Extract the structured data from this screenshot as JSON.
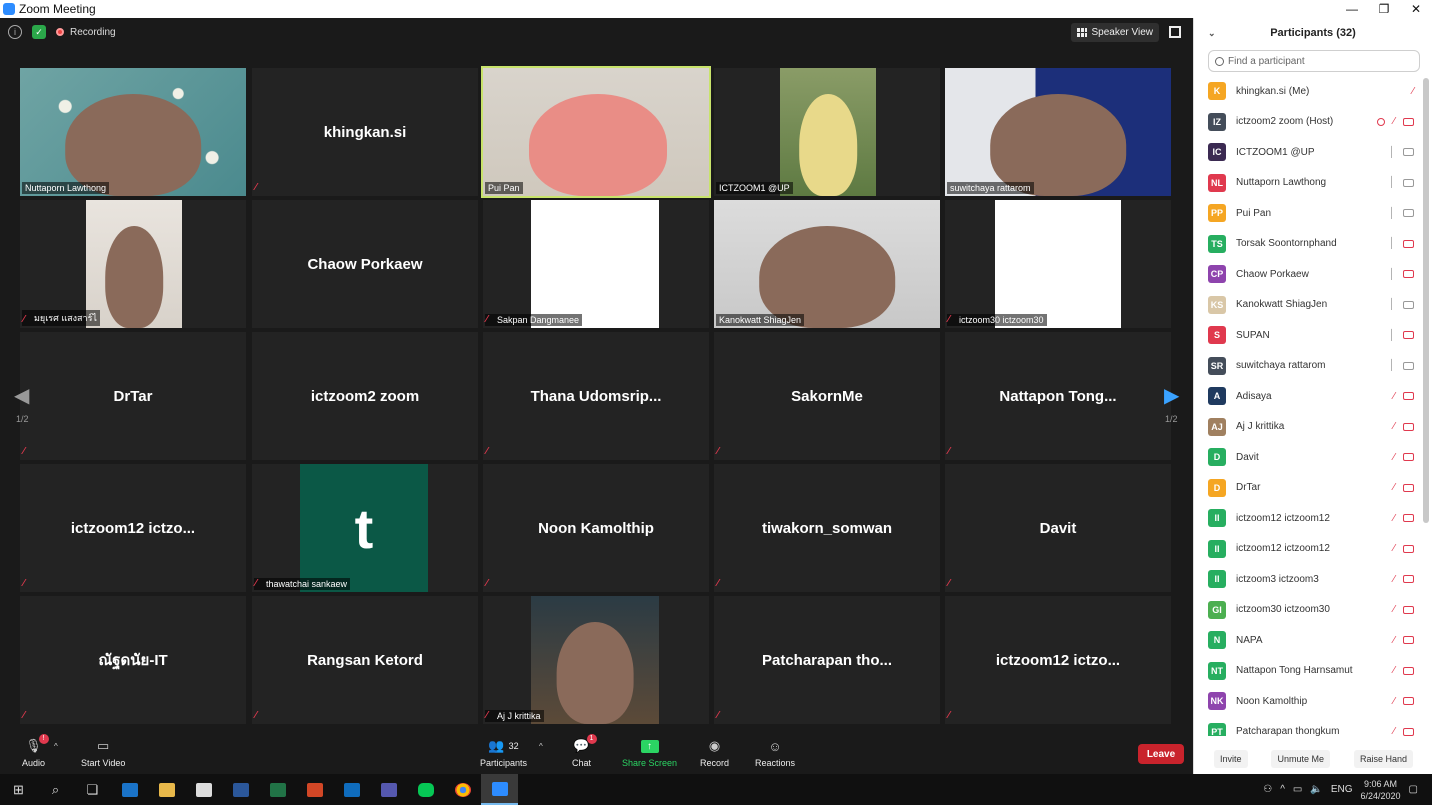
{
  "window": {
    "title": "Zoom Meeting",
    "minimize": "—",
    "restore": "❐",
    "close": "✕"
  },
  "topbar": {
    "recording_label": "Recording",
    "speaker_view_label": "Speaker View"
  },
  "grid": {
    "page_indicator_left": "1/2",
    "page_indicator_right": "1/2",
    "tiles": [
      {
        "name": "Nuttaporn Lawthong",
        "video": "blossom",
        "label": "Nuttaporn Lawthong"
      },
      {
        "name": "khingkan.si",
        "video": null,
        "muted": true
      },
      {
        "name": "Pui Pan",
        "video": "room",
        "label": "Pui Pan",
        "active": true
      },
      {
        "name": "ICTZOOM1 @UP",
        "video": "trees",
        "label": "ICTZOOM1 @UP"
      },
      {
        "name": "suwitchaya rattarom",
        "video": "office",
        "label": "suwitchaya rattarom"
      },
      {
        "name": "มยุเรศ แสงสาร์ไ",
        "video": "girl",
        "label": "มยุเรศ แสงสาร์ไ",
        "muted": true
      },
      {
        "name": "Chaow Porkaew",
        "video": null
      },
      {
        "name": "Sakpan Dangmanee",
        "video": "cartoon",
        "label": "Sakpan Dangmanee",
        "muted": true
      },
      {
        "name": "Kanokwatt ShiagJen",
        "video": "man2",
        "label": "Kanokwatt ShiagJen"
      },
      {
        "name": "ictzoom30 ictzoom30",
        "video": "gis",
        "label": "ictzoom30 ictzoom30",
        "muted": true
      },
      {
        "name": "DrTar",
        "video": null,
        "muted": true
      },
      {
        "name": "ictzoom2 zoom",
        "video": null
      },
      {
        "name": "Thana  Udomsrip...",
        "video": null,
        "muted": true
      },
      {
        "name": "SakornMe",
        "video": null,
        "muted": true
      },
      {
        "name": "Nattapon  Tong...",
        "video": null,
        "muted": true
      },
      {
        "name": "ictzoom12  ictzo...",
        "video": null,
        "muted": true
      },
      {
        "name": "thawatchai sankaew",
        "video": "t",
        "letter": "t",
        "label": "thawatchai sankaew",
        "muted": true
      },
      {
        "name": "Noon Kamolthip",
        "video": null,
        "muted": true
      },
      {
        "name": "tiwakorn_somwan",
        "video": null,
        "muted": true
      },
      {
        "name": "Davit",
        "video": null,
        "muted": true
      },
      {
        "name": "ณัฐดนัย-IT",
        "video": null,
        "muted": true
      },
      {
        "name": "Rangsan Ketord",
        "video": null,
        "muted": true
      },
      {
        "name": "Aj J krittika",
        "video": "night",
        "label": "Aj J krittika",
        "muted": true
      },
      {
        "name": "Patcharapan tho...",
        "video": null,
        "muted": true
      },
      {
        "name": "ictzoom12  ictzo...",
        "video": null,
        "muted": true
      }
    ]
  },
  "toolbar": {
    "audio": "Audio",
    "start_video": "Start Video",
    "participants": "Participants",
    "participants_count": "32",
    "chat": "Chat",
    "chat_badge": "1",
    "audio_badge": "!",
    "share_screen": "Share Screen",
    "record": "Record",
    "reactions": "Reactions",
    "leave": "Leave"
  },
  "participants": {
    "title": "Participants (32)",
    "search_placeholder": "Find a participant",
    "list": [
      {
        "initials": "K",
        "color": "#f5a623",
        "name": "khingkan.si (Me)",
        "mic": "muted",
        "cam": null
      },
      {
        "initials": "IZ",
        "color": "#444d5a",
        "name": "ictzoom2 zoom (Host)",
        "mic": "muted",
        "cam": "muted",
        "rec": true
      },
      {
        "initials": "IC",
        "color": "#3b2a52",
        "name": "ICTZOOM1 @UP",
        "mic": "on",
        "cam": "on"
      },
      {
        "initials": "NL",
        "color": "#e0394e",
        "name": "Nuttaporn Lawthong",
        "mic": "on",
        "cam": "on"
      },
      {
        "initials": "PP",
        "color": "#f5a623",
        "name": "Pui Pan",
        "mic": "on",
        "cam": "on"
      },
      {
        "initials": "TS",
        "color": "#27ae60",
        "name": "Torsak Soontornphand",
        "mic": "on",
        "cam": "muted"
      },
      {
        "initials": "CP",
        "color": "#8e44ad",
        "name": "Chaow Porkaew",
        "mic": "on",
        "cam": "muted"
      },
      {
        "initials": "KS",
        "color": "#d9c7a7",
        "name": "Kanokwatt ShiagJen",
        "mic": "on",
        "cam": "on"
      },
      {
        "initials": "S",
        "color": "#e0394e",
        "name": "SUPAN",
        "mic": "on",
        "cam": "muted"
      },
      {
        "initials": "SR",
        "color": "#444d5a",
        "name": "suwitchaya rattarom",
        "mic": "on",
        "cam": "on"
      },
      {
        "initials": "A",
        "color": "#1f3a5f",
        "name": "Adisaya",
        "mic": "muted",
        "cam": "muted"
      },
      {
        "initials": "AJ",
        "color": "#a08060",
        "name": "Aj J krittika",
        "mic": "muted",
        "cam": "muted"
      },
      {
        "initials": "D",
        "color": "#27ae60",
        "name": "Davit",
        "mic": "muted",
        "cam": "muted"
      },
      {
        "initials": "D",
        "color": "#f5a623",
        "name": "DrTar",
        "mic": "muted",
        "cam": "muted"
      },
      {
        "initials": "II",
        "color": "#27ae60",
        "name": "ictzoom12 ictzoom12",
        "mic": "muted",
        "cam": "muted"
      },
      {
        "initials": "II",
        "color": "#27ae60",
        "name": "ictzoom12 ictzoom12",
        "mic": "muted",
        "cam": "muted"
      },
      {
        "initials": "II",
        "color": "#27ae60",
        "name": "ictzoom3 ictzoom3",
        "mic": "muted",
        "cam": "muted"
      },
      {
        "initials": "GI",
        "color": "#4caf50",
        "name": "ictzoom30 ictzoom30",
        "mic": "muted",
        "cam": "muted"
      },
      {
        "initials": "N",
        "color": "#27ae60",
        "name": "NAPA",
        "mic": "muted",
        "cam": "muted"
      },
      {
        "initials": "NT",
        "color": "#27ae60",
        "name": "Nattapon Tong Harnsamut",
        "mic": "muted",
        "cam": "muted"
      },
      {
        "initials": "NK",
        "color": "#8e44ad",
        "name": "Noon Kamolthip",
        "mic": "muted",
        "cam": "muted"
      },
      {
        "initials": "PT",
        "color": "#27ae60",
        "name": "Patcharapan thongkum",
        "mic": "muted",
        "cam": "muted"
      }
    ],
    "footer": {
      "invite": "Invite",
      "unmute_me": "Unmute Me",
      "raise_hand": "Raise Hand"
    }
  },
  "taskbar": {
    "time": "9:06 AM",
    "date": "6/24/2020",
    "lang": "ENG"
  }
}
